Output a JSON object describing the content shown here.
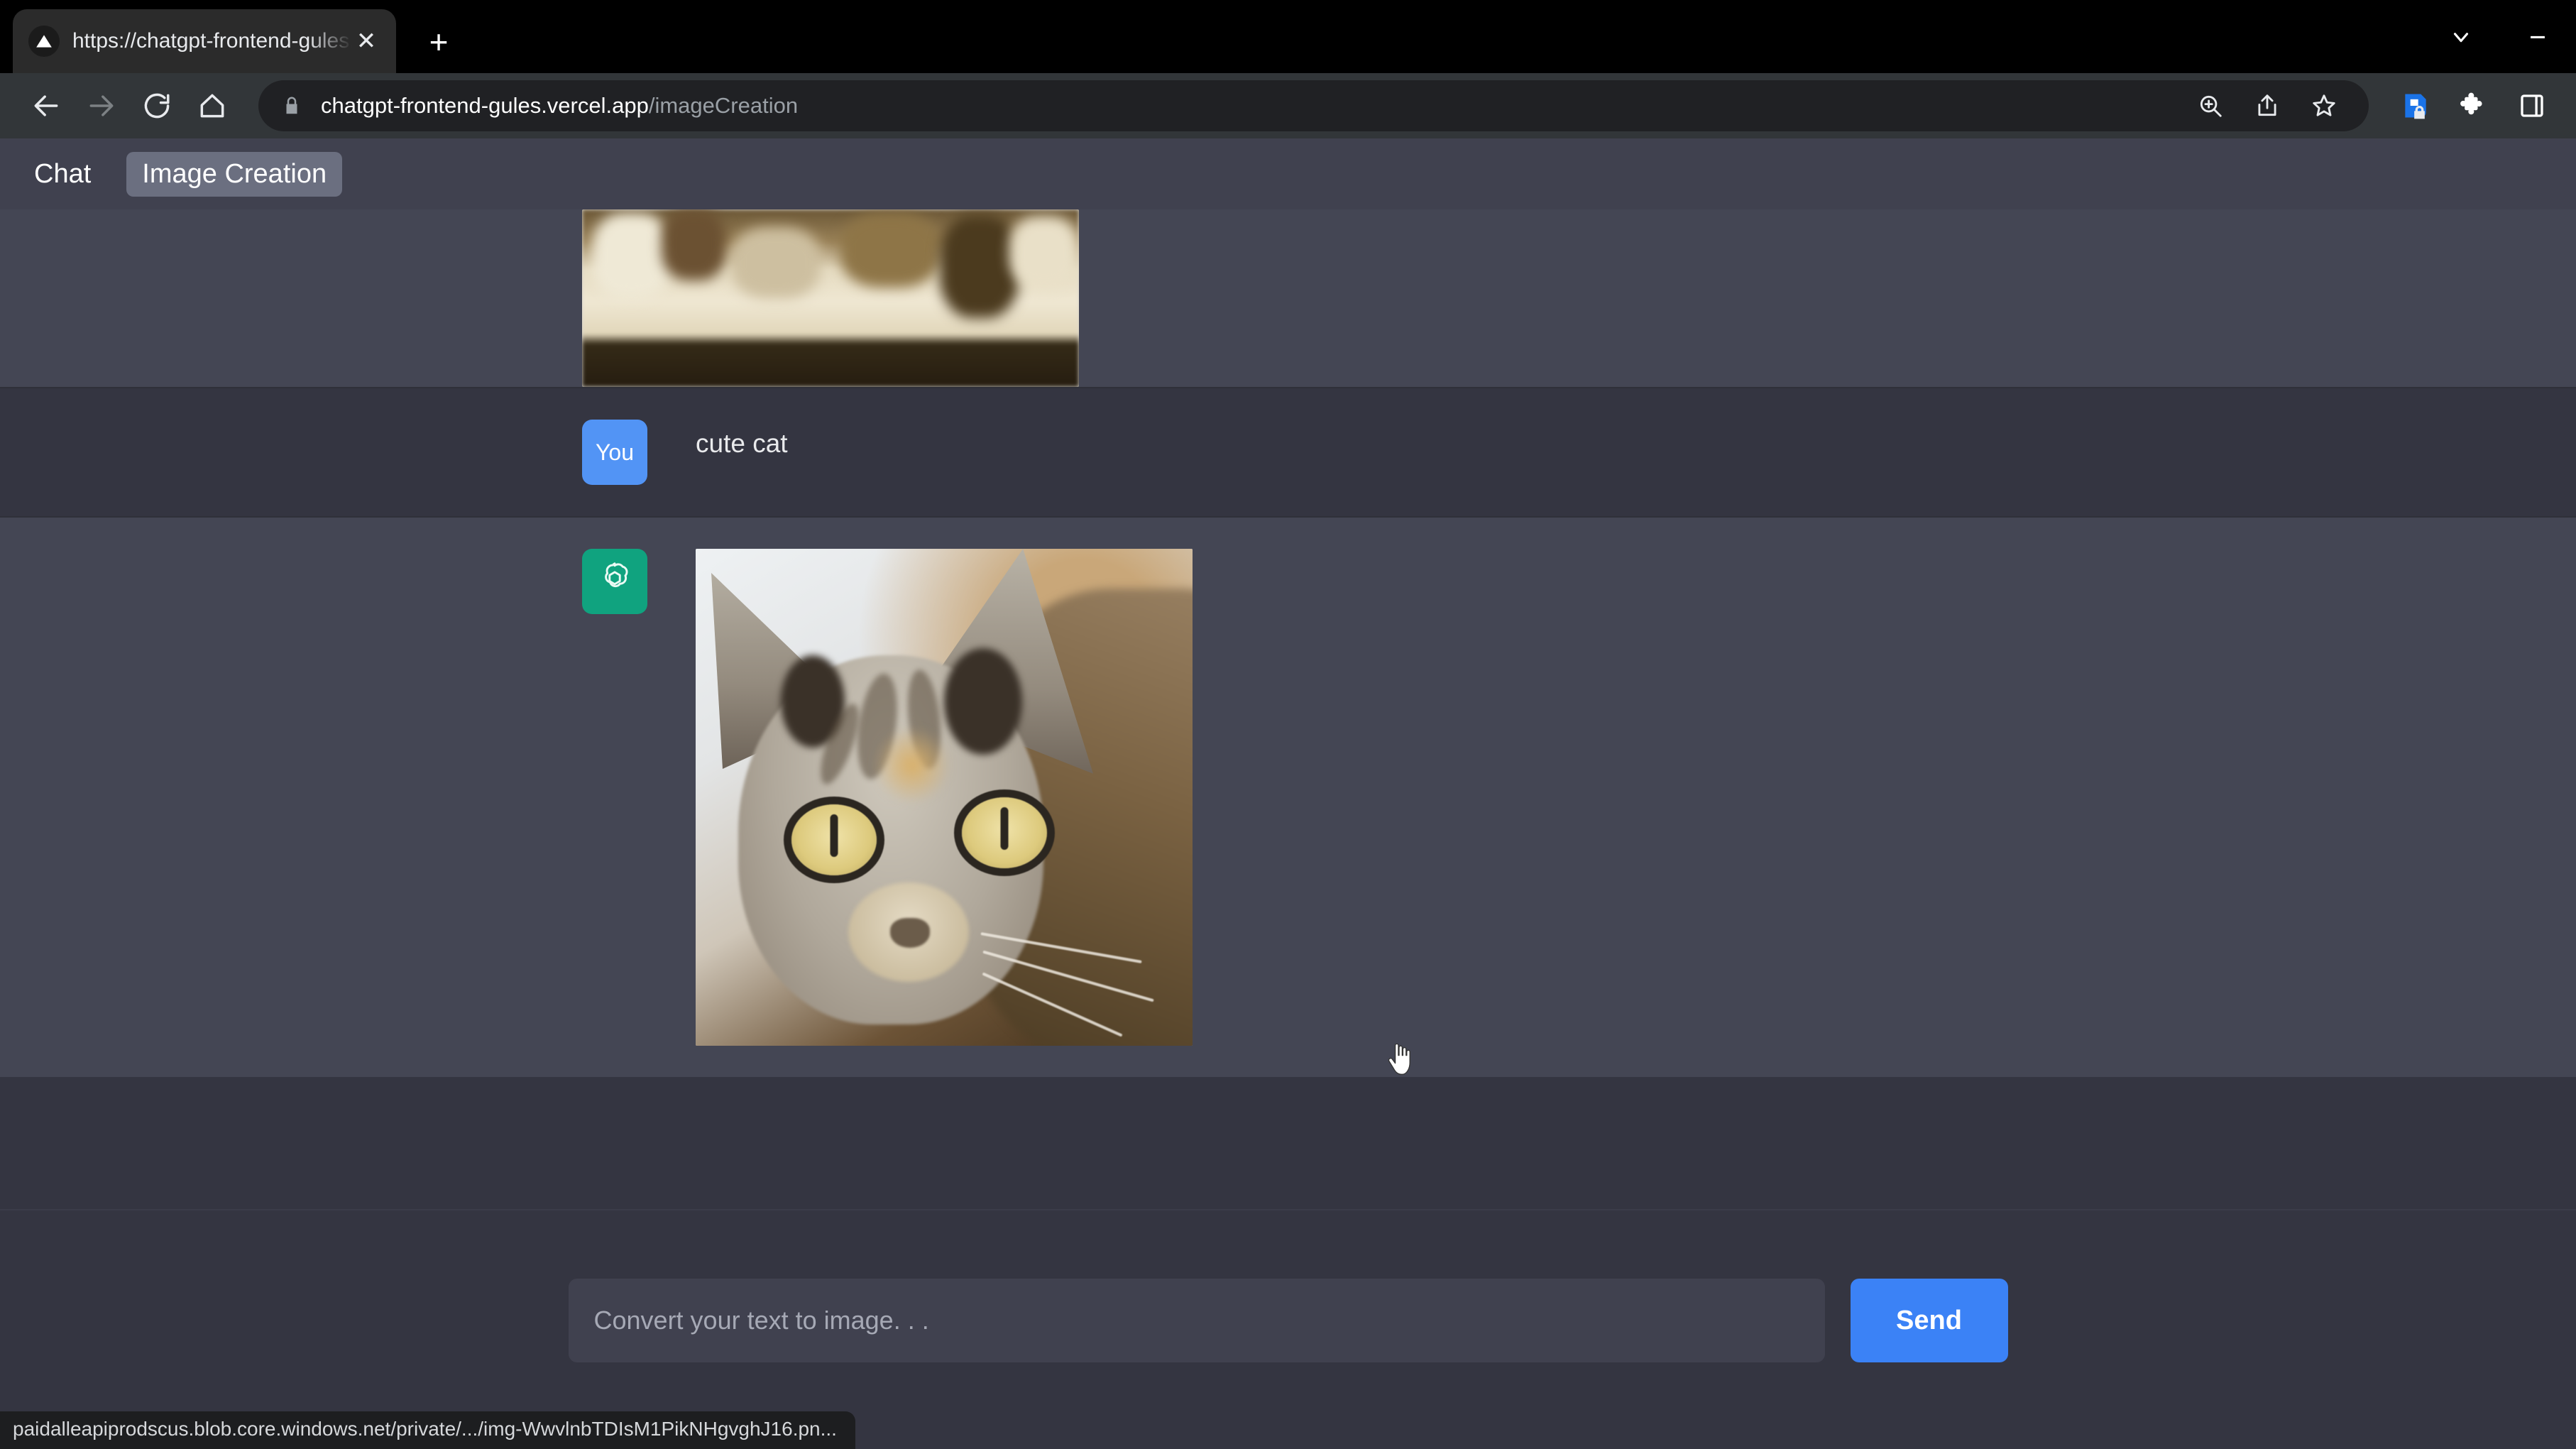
{
  "browser": {
    "tab": {
      "title": "https://chatgpt-frontend-gules.v",
      "favicon_name": "vercel-triangle-icon",
      "close_label": "✕"
    },
    "new_tab_label": "+",
    "window_controls": {
      "tab_search_label": "tab-search",
      "minimize_label": "minimize"
    },
    "nav": {
      "back_label": "Back",
      "forward_label": "Forward",
      "reload_label": "Reload",
      "home_label": "Home"
    },
    "omnibox": {
      "security_icon": "lock-icon",
      "url_domain": "chatgpt-frontend-gules.vercel.app",
      "url_path": "/imageCreation",
      "actions": [
        "zoom-in-icon",
        "share-icon",
        "bookmark-star-icon"
      ]
    },
    "extensions": [
      "shield-lock-extension-icon",
      "puzzle-extensions-icon",
      "side-panel-icon"
    ],
    "status_url": "paidalleapiprodscus.blob.core.windows.net/private/.../img-WwvlnbTDIsM1PikNHgvghJ16.pn..."
  },
  "app": {
    "nav_items": [
      {
        "label": "Chat",
        "active": false
      },
      {
        "label": "Image Creation",
        "active": true
      }
    ],
    "messages": [
      {
        "role": "assistant",
        "avatar_label": "",
        "avatar_icon": "openai-logo-icon",
        "type": "image",
        "image_alt": "generated image, clipped by scroll position",
        "clipped": true
      },
      {
        "role": "user",
        "avatar_label": "You",
        "type": "text",
        "text": "cute cat"
      },
      {
        "role": "assistant",
        "avatar_label": "",
        "avatar_icon": "openai-logo-icon",
        "type": "image",
        "image_alt": "close-up photo of a tabby cat looking at the camera",
        "clipped": false
      }
    ],
    "composer": {
      "placeholder": "Convert your text to image. . .",
      "value": "",
      "send_label": "Send"
    },
    "colors": {
      "page_bg": "#343541",
      "assistant_row_bg": "#444654",
      "nav_bar_bg": "#40414f",
      "active_nav_bg": "#6b6f80",
      "user_avatar": "#5294f5",
      "assistant_avatar": "#10a37f",
      "send_button": "#3b82f6",
      "input_bg": "#40414f"
    }
  }
}
